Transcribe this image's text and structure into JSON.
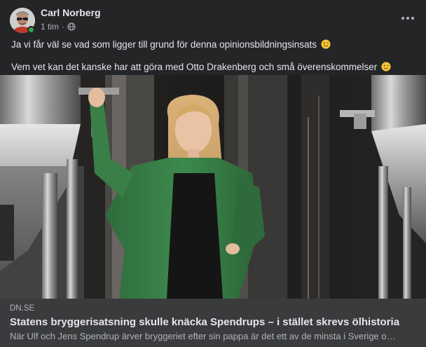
{
  "post": {
    "author": "Carl Norberg",
    "timestamp": "1 tim",
    "separator": "·",
    "privacy_icon": "globe-icon",
    "more_icon": "more-options-icon",
    "online": true,
    "paragraphs": [
      "Ja vi får väl se vad som ligger till grund för denna opinionsbildningsinsats",
      "Vem vet kan det kanske har att göra med Otto Drakenberg och små överenskommelser"
    ],
    "paragraph_emoji": "winking-face-icon"
  },
  "link": {
    "domain": "DN.SE",
    "title": "Statens bryggerisatsning skulle knäcka Spendrups – i stället skrevs ölhistoria",
    "description": "När Ulf och Jens Spendrup ärver bryggeriet efter sin pappa är det ett av de minsta i Sverige o…",
    "image": "brewery-woman-photo"
  },
  "colors": {
    "background": "#242526",
    "caption_background": "#3a3b3c",
    "primary_text": "#e4e6eb",
    "secondary_text": "#b0b3b8",
    "online_green": "#31a24c"
  }
}
